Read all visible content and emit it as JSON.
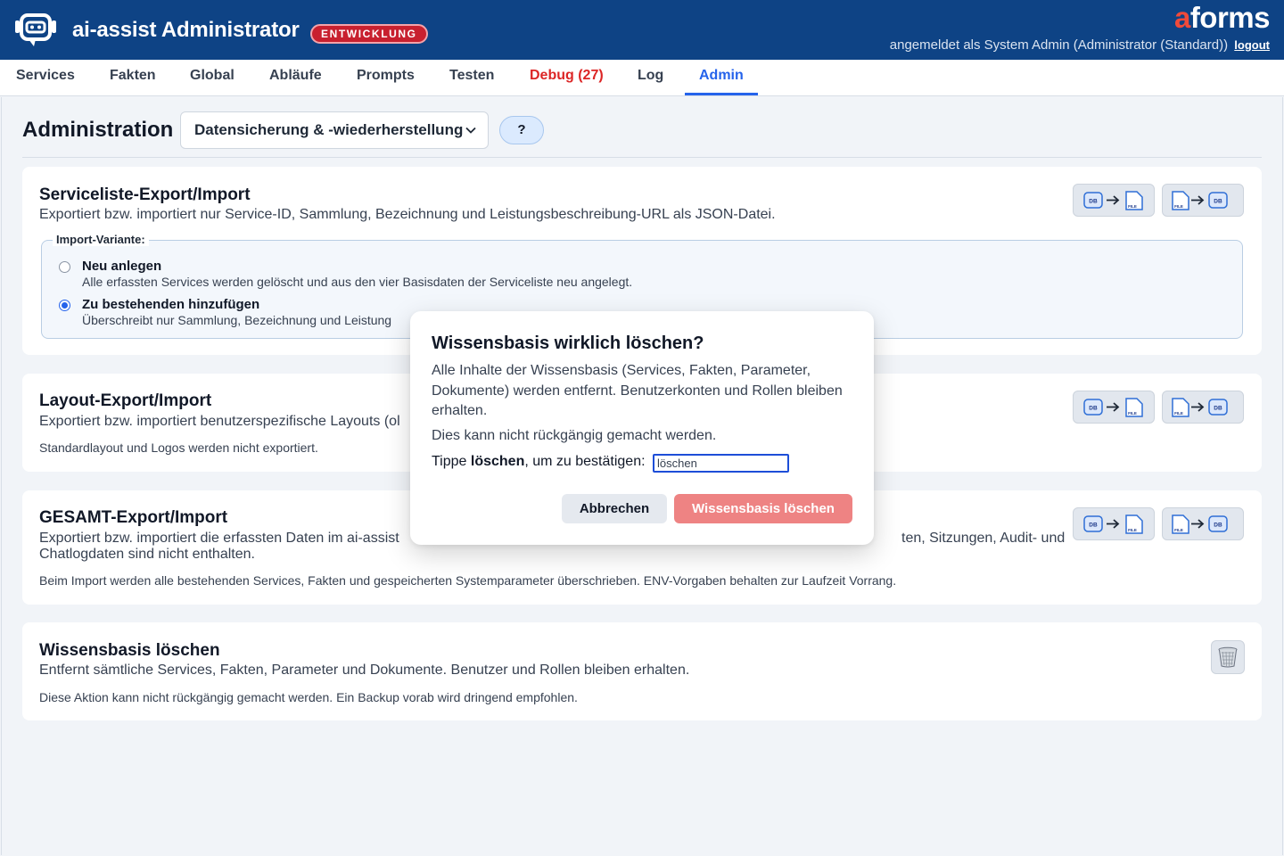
{
  "header": {
    "title": "ai-assist Administrator",
    "env_badge": "ENTWICKLUNG",
    "brand_a": "a",
    "brand_rest": "forms",
    "login_text": "angemeldet als System Admin (Administrator (Standard))",
    "logout_label": "logout"
  },
  "nav": {
    "tabs": [
      {
        "label": "Services"
      },
      {
        "label": "Fakten"
      },
      {
        "label": "Global"
      },
      {
        "label": "Abläufe"
      },
      {
        "label": "Prompts"
      },
      {
        "label": "Testen"
      },
      {
        "label": "Debug (27)"
      },
      {
        "label": "Log"
      },
      {
        "label": "Admin",
        "active": true
      }
    ]
  },
  "page": {
    "title": "Administration",
    "select_value": "Datensicherung & -wiederherstellung",
    "help_label": "?"
  },
  "cards": {
    "servicelist": {
      "title": "Serviceliste-Export/Import",
      "desc": "Exportiert bzw. importiert nur Service-ID, Sammlung, Bezeichnung und Leistungsbeschreibung-URL als JSON-Datei.",
      "legend": "Import-Variante:",
      "options": [
        {
          "label": "Neu anlegen",
          "desc": "Alle erfassten Services werden gelöscht und aus den vier Basisdaten der Serviceliste neu angelegt.",
          "checked": false
        },
        {
          "label": "Zu bestehenden hinzufügen",
          "desc": "Überschreibt nur Sammlung, Bezeichnung und Leistung",
          "checked": true
        }
      ]
    },
    "layout": {
      "title": "Layout-Export/Import",
      "desc": "Exportiert bzw. importiert benutzerspezifische Layouts (ol",
      "note": "Standardlayout und Logos werden nicht exportiert."
    },
    "total": {
      "title": "GESAMT-Export/Import",
      "desc_left": "Exportiert bzw. importiert die erfassten Daten im ai-assist",
      "desc_right": "ten, Sitzungen, Audit- und",
      "desc_line2": "Chatlogdaten sind nicht enthalten.",
      "note": "Beim Import werden alle bestehenden Services, Fakten und gespeicherten Systemparameter überschrieben. ENV-Vorgaben behalten zur Laufzeit Vorrang."
    },
    "wipe": {
      "title": "Wissensbasis löschen",
      "desc": "Entfernt sämtliche Services, Fakten, Parameter und Dokumente. Benutzer und Rollen bleiben erhalten.",
      "note": "Diese Aktion kann nicht rückgängig gemacht werden. Ein Backup vorab wird dringend empfohlen."
    }
  },
  "icons": {
    "db_label": "DB",
    "file_label": "FILE"
  },
  "dialog": {
    "title": "Wissensbasis wirklich löschen?",
    "body": "Alle Inhalte der Wissensbasis (Services, Fakten, Parameter, Dokumente) werden entfernt. Benutzerkonten und Rollen bleiben erhalten.",
    "warn": "Dies kann nicht rückgängig gemacht werden.",
    "confirm_prefix": "Tippe ",
    "confirm_word": "löschen",
    "confirm_suffix": ", um zu bestätigen:",
    "input_value": "löschen",
    "cancel_label": "Abbrechen",
    "delete_label": "Wissensbasis löschen"
  },
  "colors": {
    "header_bg": "#0e4385",
    "accent": "#2563eb",
    "danger": "#dc2626",
    "danger_soft": "#ee8383"
  }
}
